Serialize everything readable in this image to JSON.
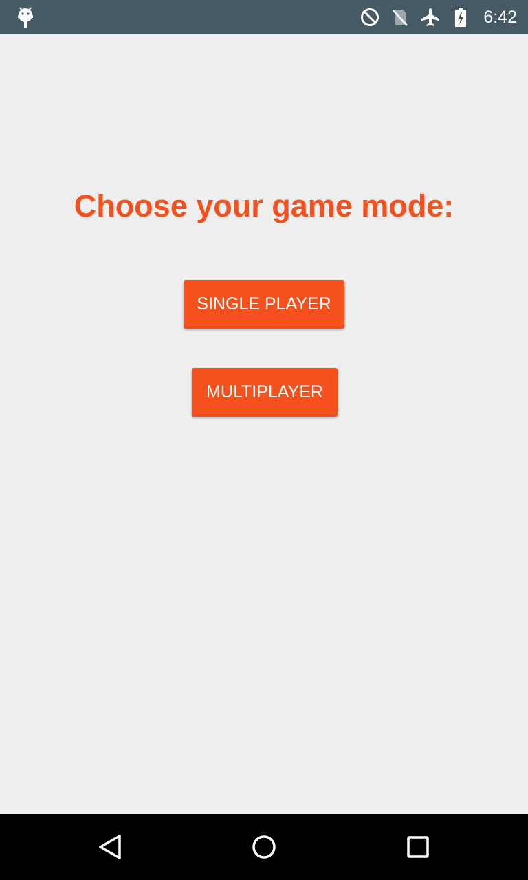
{
  "status_bar": {
    "time": "6:42",
    "icons": [
      "android-debug-icon",
      "do-not-disturb-icon",
      "no-sim-icon",
      "airplane-mode-icon",
      "battery-charging-icon"
    ]
  },
  "main": {
    "title": "Choose your game mode:",
    "buttons": {
      "single_player": "SINGLE PLAYER",
      "multiplayer": "MULTIPLAYER"
    }
  },
  "nav_bar": {
    "icons": [
      "back-icon",
      "home-icon",
      "recents-icon"
    ]
  },
  "colors": {
    "accent": "#f4511e",
    "status_bar": "#455a64",
    "background": "#eeeeee",
    "nav_bar": "#000000"
  }
}
